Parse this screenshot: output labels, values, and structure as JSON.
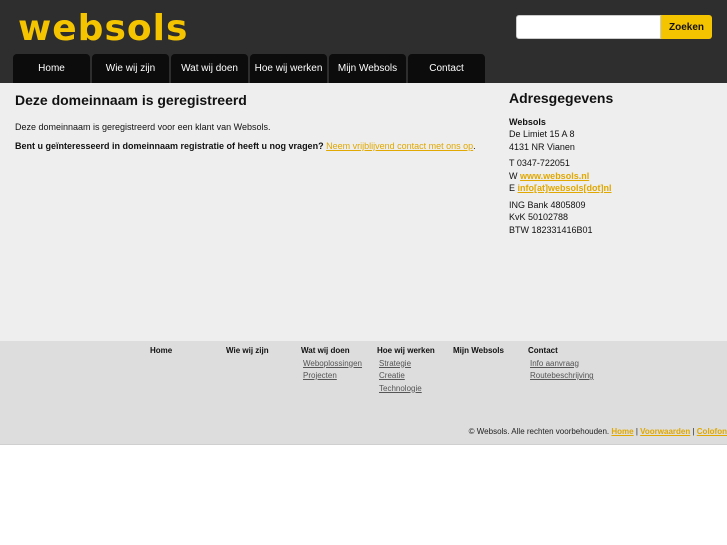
{
  "brand": {
    "logo_text": "websols"
  },
  "search": {
    "placeholder": "",
    "value": "",
    "button_label": "Zoeken"
  },
  "nav": [
    "Home",
    "Wie wij zijn",
    "Wat wij doen",
    "Hoe wij werken",
    "Mijn Websols",
    "Contact"
  ],
  "main": {
    "title": "Deze domeinnaam is geregistreerd",
    "intro": "Deze domeinnaam is geregistreerd voor een klant van Websols.",
    "question": "Bent u geïnteresseerd in domeinnaam registratie of heeft u nog vragen?",
    "contact_link": "Neem vrijblijvend contact met ons op",
    "period": "."
  },
  "address": {
    "title": "Adresgegevens",
    "company": "Websols",
    "street": "De Limiet 15 A 8",
    "city": "4131 NR Vianen",
    "phone": "T 0347-722051",
    "web_prefix": "W",
    "web_link": "www.websols.nl",
    "email_prefix": "E",
    "email_link": "info[at]websols[dot]nl",
    "bank": "ING Bank 4805809",
    "kvk": "KvK 50102788",
    "btw": "BTW 182331416B01"
  },
  "footer": {
    "columns": [
      {
        "heading": "Home",
        "links": []
      },
      {
        "heading": "Wie wij zijn",
        "links": []
      },
      {
        "heading": "Wat wij doen",
        "links": [
          "Weboplossingen",
          "Projecten"
        ]
      },
      {
        "heading": "Hoe wij werken",
        "links": [
          "Strategie",
          "Creatie",
          "Technologie"
        ]
      },
      {
        "heading": "Mijn Websols",
        "links": []
      },
      {
        "heading": "Contact",
        "links": [
          "Info aanvraag",
          "Routebeschrijving"
        ]
      }
    ],
    "copyright": "© Websols. Alle rechten voorbehouden.",
    "links": [
      "Home",
      "Voorwaarden",
      "Colofon"
    ],
    "separator": " | "
  },
  "colors": {
    "accent": "#f5c400",
    "header_bg": "#2e2e2e",
    "nav_bg": "#0c0c0c",
    "main_bg": "#eeeeee",
    "footer_bg": "#dddddd",
    "link": "#e0a800"
  }
}
